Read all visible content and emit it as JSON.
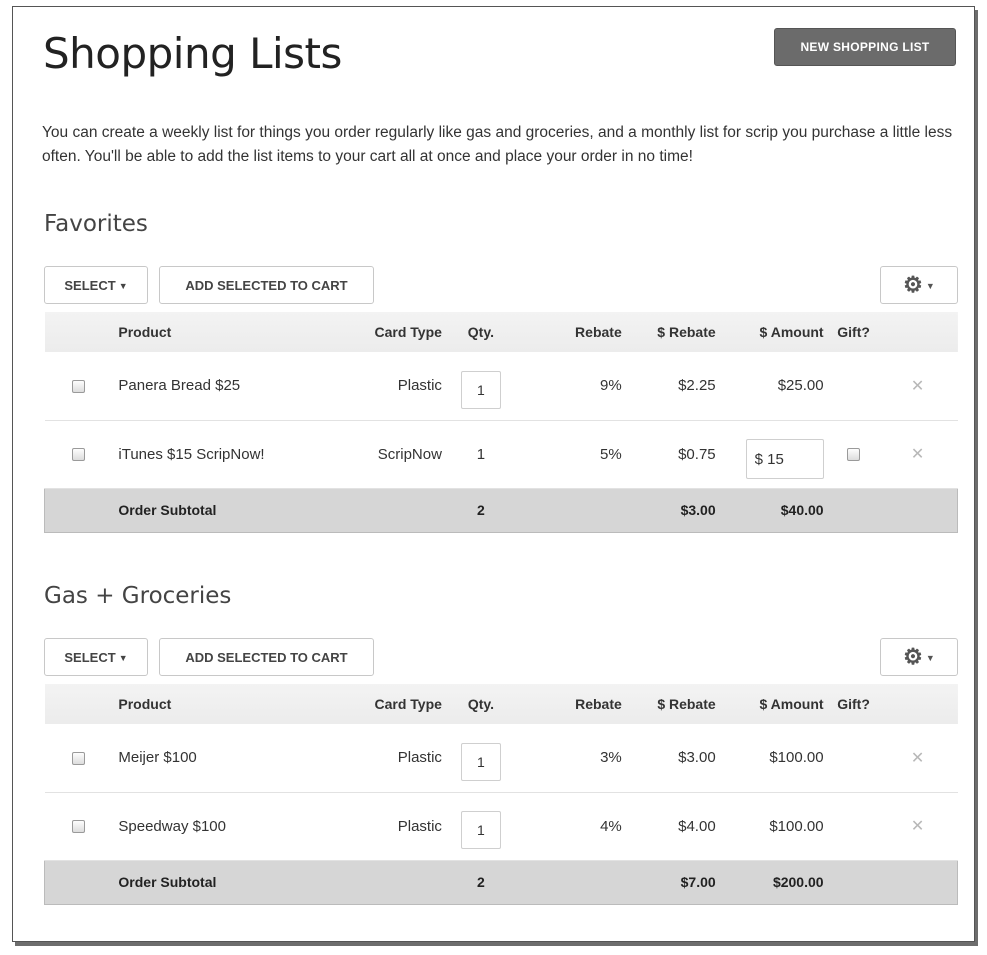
{
  "header": {
    "title": "Shopping Lists",
    "new_button": "NEW SHOPPING LIST"
  },
  "intro": "You can create a weekly list for things you order regularly like gas and groceries, and a monthly list for scrip you purchase a little less often. You'll be able to add the list items to your cart all at once and place your order in no time!",
  "toolbar": {
    "select_label": "SELECT",
    "add_label": "ADD SELECTED TO CART",
    "gear_icon": "gear-icon"
  },
  "columns": [
    "Product",
    "Card Type",
    "Qty.",
    "Rebate",
    "$ Rebate",
    "$ Amount",
    "Gift?"
  ],
  "lists": [
    {
      "title": "Favorites",
      "rows": [
        {
          "product": "Panera Bread $25",
          "card_type": "Plastic",
          "qty": "1",
          "rebate": "9%",
          "rebate_amt": "$2.25",
          "amount": "$25.00"
        },
        {
          "product": "iTunes $15 ScripNow!",
          "card_type": "ScripNow",
          "qty": "1",
          "rebate": "5%",
          "rebate_amt": "$0.75",
          "amount": "$ 15"
        }
      ],
      "subtotal": {
        "label": "Order Subtotal",
        "qty": "2",
        "rebate_amt": "$3.00",
        "amount": "$40.00"
      }
    },
    {
      "title": "Gas + Groceries",
      "rows": [
        {
          "product": "Meijer $100",
          "card_type": "Plastic",
          "qty": "1",
          "rebate": "3%",
          "rebate_amt": "$3.00",
          "amount": "$100.00"
        },
        {
          "product": "Speedway $100",
          "card_type": "Plastic",
          "qty": "1",
          "rebate": "4%",
          "rebate_amt": "$4.00",
          "amount": "$100.00"
        }
      ],
      "subtotal": {
        "label": "Order Subtotal",
        "qty": "2",
        "rebate_amt": "$7.00",
        "amount": "$200.00"
      }
    }
  ]
}
